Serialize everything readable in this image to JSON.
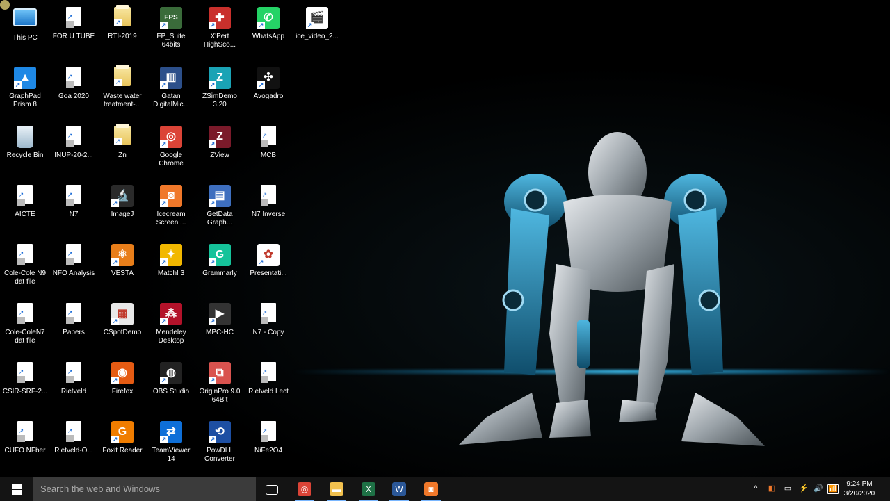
{
  "desktop": {
    "columns": [
      [
        {
          "label": "This PC",
          "icon": "this-pc-icon",
          "kind": "pc"
        },
        {
          "label": "GraphPad Prism 8",
          "icon": "graphpad-prism-icon",
          "kind": "app",
          "color": "#1e88e5",
          "glyph": "▲"
        },
        {
          "label": "Recycle Bin",
          "icon": "recycle-bin-icon",
          "kind": "bin"
        },
        {
          "label": "AICTE",
          "icon": "file-icon",
          "kind": "file"
        },
        {
          "label": "Cole-Cole N9 dat file",
          "icon": "file-icon",
          "kind": "file"
        },
        {
          "label": "Cole-ColeN7 dat file",
          "icon": "file-icon",
          "kind": "file"
        },
        {
          "label": "CSIR-SRF-2...",
          "icon": "file-icon",
          "kind": "file"
        },
        {
          "label": "CUFO NFber",
          "icon": "file-icon",
          "kind": "file"
        }
      ],
      [
        {
          "label": "FOR U TUBE",
          "icon": "folder-icon",
          "kind": "file"
        },
        {
          "label": "Goa 2020",
          "icon": "file-icon",
          "kind": "file"
        },
        {
          "label": "INUP-20-2...",
          "icon": "file-icon",
          "kind": "file"
        },
        {
          "label": "N7",
          "icon": "file-icon",
          "kind": "file"
        },
        {
          "label": "NFO Analysis",
          "icon": "file-icon",
          "kind": "file"
        },
        {
          "label": "Papers",
          "icon": "file-icon",
          "kind": "file"
        },
        {
          "label": "Rietveld",
          "icon": "file-icon",
          "kind": "file"
        },
        {
          "label": "Rietveld-O...",
          "icon": "file-icon",
          "kind": "file"
        }
      ],
      [
        {
          "label": "RTI-2019",
          "icon": "folder-icon",
          "kind": "folder"
        },
        {
          "label": "Waste water treatment-...",
          "icon": "folder-icon",
          "kind": "folder"
        },
        {
          "label": "Zn",
          "icon": "folder-icon",
          "kind": "folder"
        },
        {
          "label": "ImageJ",
          "icon": "imagej-icon",
          "kind": "app",
          "color": "#2a2a2a",
          "glyph": "🔬"
        },
        {
          "label": "VESTA",
          "icon": "vesta-icon",
          "kind": "app",
          "color": "#e87e1a",
          "glyph": "⚛"
        },
        {
          "label": "CSpotDemo",
          "icon": "cspot-icon",
          "kind": "app",
          "color": "#e8e8e8",
          "glyph": "▦"
        },
        {
          "label": "Firefox",
          "icon": "firefox-icon",
          "kind": "app",
          "color": "#e55b13",
          "glyph": "◉"
        },
        {
          "label": "Foxit Reader",
          "icon": "foxit-reader-icon",
          "kind": "app",
          "color": "#f07d00",
          "glyph": "G"
        }
      ],
      [
        {
          "label": "FP_Suite 64bits",
          "icon": "fp-suite-icon",
          "kind": "app",
          "color": "#3a6b3a",
          "glyph": "FPS"
        },
        {
          "label": "Gatan DigitalMic...",
          "icon": "gatan-icon",
          "kind": "app",
          "color": "#2c4f8a",
          "glyph": "▥"
        },
        {
          "label": "Google Chrome",
          "icon": "chrome-icon",
          "kind": "app",
          "color": "#db4437",
          "glyph": "◎"
        },
        {
          "label": "Icecream Screen ...",
          "icon": "icecream-icon",
          "kind": "app",
          "color": "#f0782a",
          "glyph": "◙"
        },
        {
          "label": "Match! 3",
          "icon": "match-icon",
          "kind": "app",
          "color": "#f2b800",
          "glyph": "✦"
        },
        {
          "label": "Mendeley Desktop",
          "icon": "mendeley-icon",
          "kind": "app",
          "color": "#b3122a",
          "glyph": "⁂"
        },
        {
          "label": "OBS Studio",
          "icon": "obs-icon",
          "kind": "app",
          "color": "#222",
          "glyph": "◍"
        },
        {
          "label": "TeamViewer 14",
          "icon": "teamviewer-icon",
          "kind": "app",
          "color": "#0e6fd8",
          "glyph": "⇄"
        }
      ],
      [
        {
          "label": "X'Pert HighSco...",
          "icon": "xpert-icon",
          "kind": "app",
          "color": "#c9302c",
          "glyph": "✚"
        },
        {
          "label": "ZSimDemo 3.20",
          "icon": "zsimdemo-icon",
          "kind": "app",
          "color": "#1aa3b5",
          "glyph": "Z"
        },
        {
          "label": "ZView",
          "icon": "zview-icon",
          "kind": "app",
          "color": "#7a1a2a",
          "glyph": "Z"
        },
        {
          "label": "GetData Graph...",
          "icon": "getdata-icon",
          "kind": "app",
          "color": "#3e6fbf",
          "glyph": "▤"
        },
        {
          "label": "Grammarly",
          "icon": "grammarly-icon",
          "kind": "app",
          "color": "#15c39a",
          "glyph": "G"
        },
        {
          "label": "MPC-HC",
          "icon": "mpc-hc-icon",
          "kind": "app",
          "color": "#333",
          "glyph": "▶"
        },
        {
          "label": "OriginPro 9.0 64Bit",
          "icon": "originpro-icon",
          "kind": "app",
          "color": "#d9534f",
          "glyph": "⧉"
        },
        {
          "label": "PowDLL Converter",
          "icon": "powdll-icon",
          "kind": "app",
          "color": "#1d4fa3",
          "glyph": "⟲"
        }
      ],
      [
        {
          "label": "WhatsApp",
          "icon": "whatsapp-icon",
          "kind": "app",
          "color": "#25d366",
          "glyph": "✆"
        },
        {
          "label": "Avogadro",
          "icon": "avogadro-icon",
          "kind": "app",
          "color": "#111",
          "glyph": "✣"
        },
        {
          "label": "MCB",
          "icon": "file-icon",
          "kind": "file"
        },
        {
          "label": "N7 Inverse",
          "icon": "file-icon",
          "kind": "file"
        },
        {
          "label": "Presentati...",
          "icon": "presentation-icon",
          "kind": "app",
          "color": "#ffffff",
          "glyph": "✿"
        },
        {
          "label": "N7 - Copy",
          "icon": "file-icon",
          "kind": "file"
        },
        {
          "label": "Rietveld Lect",
          "icon": "file-icon",
          "kind": "file"
        },
        {
          "label": "NiFe2O4",
          "icon": "file-icon",
          "kind": "file"
        }
      ],
      [
        {
          "label": "ice_video_2...",
          "icon": "video-file-icon",
          "kind": "app",
          "color": "#ffffff",
          "glyph": "🎬"
        }
      ]
    ]
  },
  "taskbar": {
    "search_placeholder": "Search the web and Windows",
    "pinned": [
      {
        "name": "task-view-button",
        "color": "#141414",
        "glyph": "▭"
      },
      {
        "name": "taskbar-chrome-button",
        "color": "#db4437",
        "glyph": "◎"
      },
      {
        "name": "taskbar-file-explorer-button",
        "color": "#f2c14e",
        "glyph": "▬"
      },
      {
        "name": "taskbar-excel-button",
        "color": "#1e7145",
        "glyph": "X"
      },
      {
        "name": "taskbar-word-button",
        "color": "#2b5797",
        "glyph": "W"
      },
      {
        "name": "taskbar-icecream-button",
        "color": "#f0782a",
        "glyph": "◙"
      }
    ],
    "tray": [
      "^",
      "◧",
      "▭",
      "⚡",
      "🔊",
      "📶"
    ],
    "time": "9:24 PM",
    "date": "3/20/2020"
  }
}
